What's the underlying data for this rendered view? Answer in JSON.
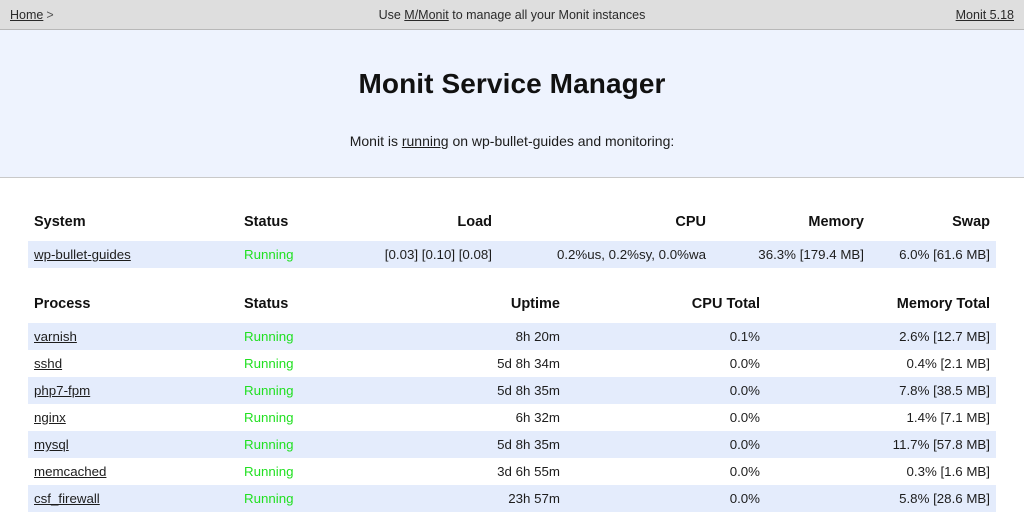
{
  "topbar": {
    "breadcrumb_home": "Home",
    "breadcrumb_separator": ">",
    "notice_prefix": "Use ",
    "notice_link": "M/Monit",
    "notice_suffix": " to manage all your Monit instances",
    "version": "Monit 5.18"
  },
  "header": {
    "title": "Monit Service Manager",
    "subtitle_prefix": "Monit is ",
    "subtitle_link": "running",
    "subtitle_suffix": " on wp-bullet-guides and monitoring:"
  },
  "system_table": {
    "headers": {
      "name": "System",
      "status": "Status",
      "load": "Load",
      "cpu": "CPU",
      "memory": "Memory",
      "swap": "Swap"
    },
    "rows": [
      {
        "name": "wp-bullet-guides",
        "status": "Running",
        "load": "[0.03] [0.10] [0.08]",
        "cpu": "0.2%us, 0.2%sy, 0.0%wa",
        "memory": "36.3% [179.4 MB]",
        "swap": "6.0% [61.6 MB]"
      }
    ]
  },
  "process_table": {
    "headers": {
      "name": "Process",
      "status": "Status",
      "uptime": "Uptime",
      "cpu_total": "CPU Total",
      "memory_total": "Memory Total"
    },
    "rows": [
      {
        "name": "varnish",
        "status": "Running",
        "uptime": "8h 20m",
        "cpu_total": "0.1%",
        "memory_total": "2.6% [12.7 MB]"
      },
      {
        "name": "sshd",
        "status": "Running",
        "uptime": "5d 8h 34m",
        "cpu_total": "0.0%",
        "memory_total": "0.4% [2.1 MB]"
      },
      {
        "name": "php7-fpm",
        "status": "Running",
        "uptime": "5d 8h 35m",
        "cpu_total": "0.0%",
        "memory_total": "7.8% [38.5 MB]"
      },
      {
        "name": "nginx",
        "status": "Running",
        "uptime": "6h 32m",
        "cpu_total": "0.0%",
        "memory_total": "1.4% [7.1 MB]"
      },
      {
        "name": "mysql",
        "status": "Running",
        "uptime": "5d 8h 35m",
        "cpu_total": "0.0%",
        "memory_total": "11.7% [57.8 MB]"
      },
      {
        "name": "memcached",
        "status": "Running",
        "uptime": "3d 6h 55m",
        "cpu_total": "0.0%",
        "memory_total": "0.3% [1.6 MB]"
      },
      {
        "name": "csf_firewall",
        "status": "Running",
        "uptime": "23h 57m",
        "cpu_total": "0.0%",
        "memory_total": "5.8% [28.6 MB]"
      }
    ]
  },
  "colors": {
    "topbar_background": "#dedede",
    "header_background": "#eef3fe",
    "row_stripe": "#e4ecfc",
    "status_running": "#22e022",
    "text": "#1d1d1d"
  }
}
